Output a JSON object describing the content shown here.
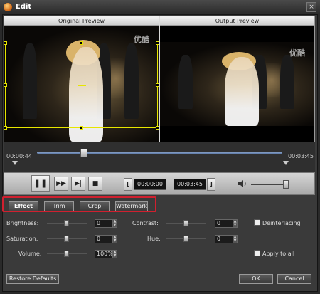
{
  "window": {
    "title": "Edit",
    "close_glyph": "×"
  },
  "preview": {
    "original_label": "Original Preview",
    "output_label": "Output Preview",
    "watermark_text": "优酷"
  },
  "timeline": {
    "start_time": "00:00:44",
    "end_time": "00:03:45",
    "position_fraction": 0.19
  },
  "controls": {
    "play_glyph": "❚❚",
    "next_frame_glyph": "▶▶",
    "step_glyph": "▶|",
    "stop_glyph": "■",
    "bracket_left": "[",
    "bracket_right": "]",
    "trim_start": "00:00:00",
    "trim_end": "00:03:45",
    "volume_icon": "speaker-icon",
    "volume_level": 0.95
  },
  "tabs": [
    {
      "label": "Effect",
      "active": true
    },
    {
      "label": "Trim",
      "active": false
    },
    {
      "label": "Crop",
      "active": false
    },
    {
      "label": "Watermark",
      "active": false
    }
  ],
  "effect": {
    "brightness": {
      "label": "Brightness:",
      "value": "0",
      "level": 0.5
    },
    "saturation": {
      "label": "Saturation:",
      "value": "0",
      "level": 0.5
    },
    "volume": {
      "label": "Volume:",
      "value": "100%",
      "level": 0.5
    },
    "contrast": {
      "label": "Contrast:",
      "value": "0",
      "level": 0.5
    },
    "hue": {
      "label": "Hue:",
      "value": "0",
      "level": 0.5
    },
    "deinterlacing": {
      "label": "Deinterlacing",
      "checked": false
    },
    "apply_all": {
      "label": "Apply to all",
      "checked": false
    }
  },
  "footer": {
    "restore_label": "Restore Defaults",
    "ok_label": "OK",
    "cancel_label": "Cancel"
  },
  "colors": {
    "highlight": "#d0202f",
    "crop_border": "#e6e600"
  }
}
